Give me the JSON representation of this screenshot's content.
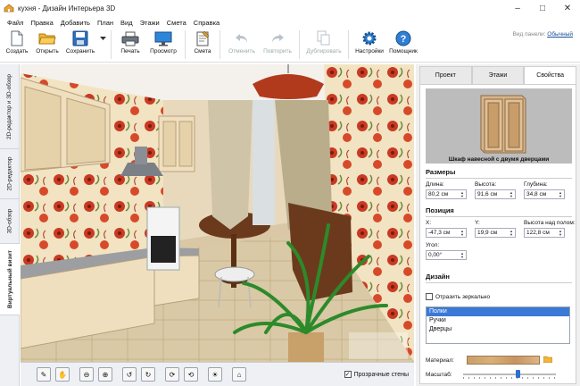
{
  "window": {
    "title": "кухня - Дизайн Интерьера 3D"
  },
  "menu": [
    "Файл",
    "Правка",
    "Добавить",
    "План",
    "Вид",
    "Этажи",
    "Смета",
    "Справка"
  ],
  "toolbar": {
    "create": "Создать",
    "open": "Открыть",
    "save": "Сохранить",
    "print": "Печать",
    "preview": "Просмотр",
    "estimate": "Смета",
    "undo": "Отменить",
    "redo": "Повторить",
    "duplicate": "Дублировать",
    "settings": "Настройки",
    "help": "Помощник",
    "panel_view_label": "Вид панели:",
    "panel_view_value": "Обычный"
  },
  "left_tabs": [
    "2D-редактор и 3D-обзор",
    "2D-редактор",
    "3D-обзор",
    "Виртуальный визит"
  ],
  "left_tabs_active": "Виртуальный визит",
  "viewport": {
    "transparent_walls_label": "Прозрачные стены",
    "transparent_walls_checked": true
  },
  "right_panel": {
    "tabs": [
      "Проект",
      "Этажи",
      "Свойства"
    ],
    "active_tab": "Свойства",
    "object_name": "Шкаф навесной с двумя дверцами",
    "sizes": {
      "header": "Размеры",
      "length_label": "Длина:",
      "length": "80,2 см",
      "height_label": "Высота:",
      "height": "91,6 см",
      "depth_label": "Глубина:",
      "depth": "34,8 см"
    },
    "position": {
      "header": "Позиция",
      "x_label": "X:",
      "x": "-47,3 см",
      "y_label": "Y:",
      "y": "19,9 см",
      "floor_label": "Высота над полом:",
      "floor": "122,8 см",
      "angle_label": "Угол:",
      "angle": "0,00°"
    },
    "design": {
      "header": "Дизайн",
      "mirror_label": "Отразить зеркально",
      "items": [
        "Полки",
        "Ручки",
        "Дверцы"
      ],
      "selected_item": "Полки",
      "material_label": "Материал:",
      "scale_label": "Масштаб:",
      "scale_value_percent": 60
    }
  }
}
